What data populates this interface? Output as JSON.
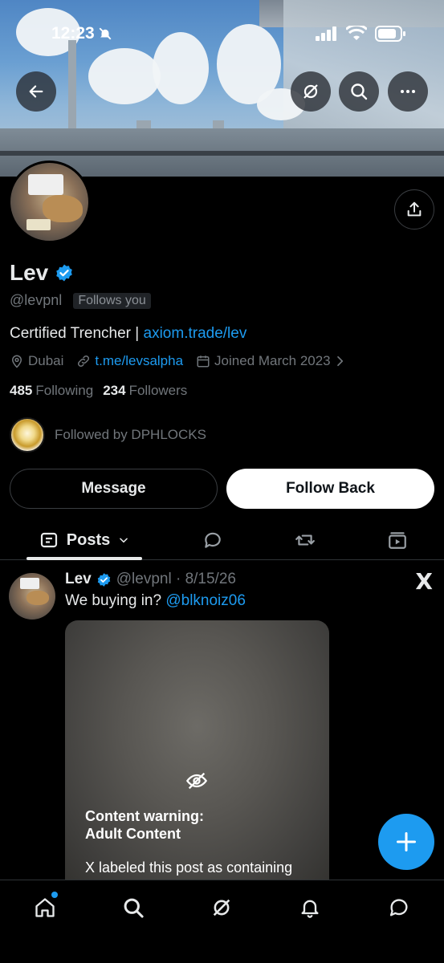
{
  "status_bar": {
    "time": "12:23"
  },
  "profile": {
    "name": "Lev",
    "handle": "@levpnl",
    "follows_you": "Follows you",
    "bio_text": "Certified Trencher | ",
    "bio_link": "axiom.trade/lev",
    "location": "Dubai",
    "website": "t.me/levsalpha",
    "joined": "Joined March 2023",
    "following_count": "485",
    "following_label": "Following",
    "followers_count": "234",
    "followers_label": "Followers",
    "followed_by": "Followed by DPHLOCKS"
  },
  "actions": {
    "message": "Message",
    "follow_back": "Follow Back"
  },
  "tabs": {
    "posts": "Posts"
  },
  "post": {
    "author": "Lev",
    "handle_date": "@levpnl · 8/15/26",
    "text_prefix": "We buying in? ",
    "mention": "@blknoiz06",
    "x_logo": "X",
    "cw_title_line1": "Content warning:",
    "cw_title_line2": "Adult Content",
    "cw_desc": "X labeled this post as containing"
  },
  "colors": {
    "accent": "#1d9bf0",
    "background": "#000000",
    "muted": "#71767b"
  }
}
